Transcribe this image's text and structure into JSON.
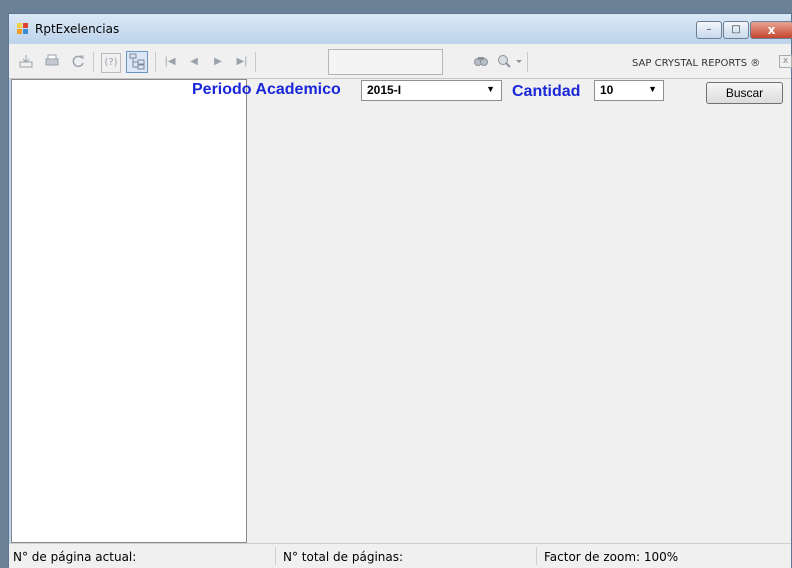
{
  "window": {
    "title": "RptExelencias",
    "icon": "app-window-icon",
    "buttons": {
      "minimize": "–",
      "maximize": "□",
      "close": "x"
    }
  },
  "toolbar": {
    "icons": [
      "export-icon",
      "print-icon",
      "refresh-icon",
      "help-icon",
      "group-tree-icon",
      "first-page-icon",
      "prev-page-icon",
      "next-page-icon",
      "last-page-icon",
      "find-icon",
      "zoom-icon"
    ],
    "goto_value": "",
    "brand": "SAP CRYSTAL REPORTS ®",
    "brand_close": "x"
  },
  "filters": {
    "periodo_label": "Periodo Academico",
    "periodo_value": "2015-I",
    "cantidad_label": "Cantidad",
    "cantidad_value": "10",
    "buscar_label": "Buscar"
  },
  "statusbar": {
    "current_page": "N° de página actual:",
    "total_pages": "N° total de páginas:",
    "zoom": "Factor de zoom: 100%"
  },
  "colors": {
    "label_blue": "#1a27d8",
    "close_red": "#c6452f",
    "title_bg": "#bcd3eb"
  }
}
